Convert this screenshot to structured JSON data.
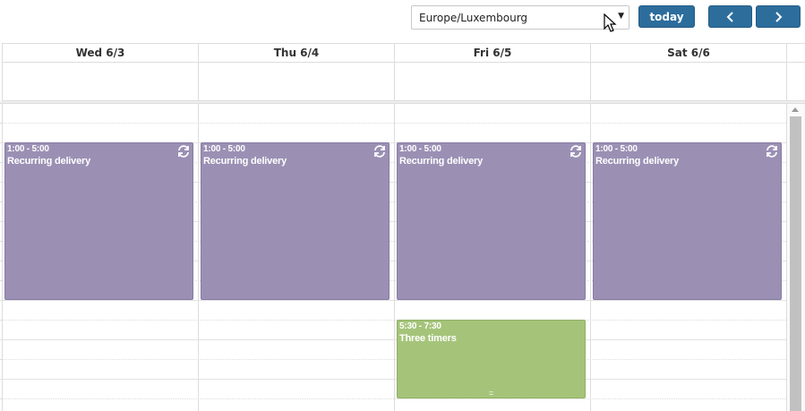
{
  "toolbar": {
    "timezone": "Europe/Luxembourg",
    "today_label": "today"
  },
  "days": [
    {
      "label": "Wed 6/3"
    },
    {
      "label": "Thu 6/4"
    },
    {
      "label": "Fri 6/5"
    },
    {
      "label": "Sat 6/6"
    }
  ],
  "events": [
    {
      "day": "Wed 6/3",
      "time": "1:00 - 5:00",
      "title": "Recurring delivery",
      "recurring": true,
      "color": "#9b90b4"
    },
    {
      "day": "Thu 6/4",
      "time": "1:00 - 5:00",
      "title": "Recurring delivery",
      "recurring": true,
      "color": "#9b90b4"
    },
    {
      "day": "Fri 6/5",
      "time": "1:00 - 5:00",
      "title": "Recurring delivery",
      "recurring": true,
      "color": "#9b90b4"
    },
    {
      "day": "Sat 6/6",
      "time": "1:00 - 5:00",
      "title": "Recurring delivery",
      "recurring": true,
      "color": "#9b90b4"
    },
    {
      "day": "Fri 6/5",
      "time": "5:30 - 7:30",
      "title": "Three timers",
      "recurring": false,
      "color": "#a5c47a"
    }
  ],
  "colors": {
    "button": "#2c6d9c",
    "recurring_event": "#9b90b4",
    "single_event": "#a5c47a"
  }
}
